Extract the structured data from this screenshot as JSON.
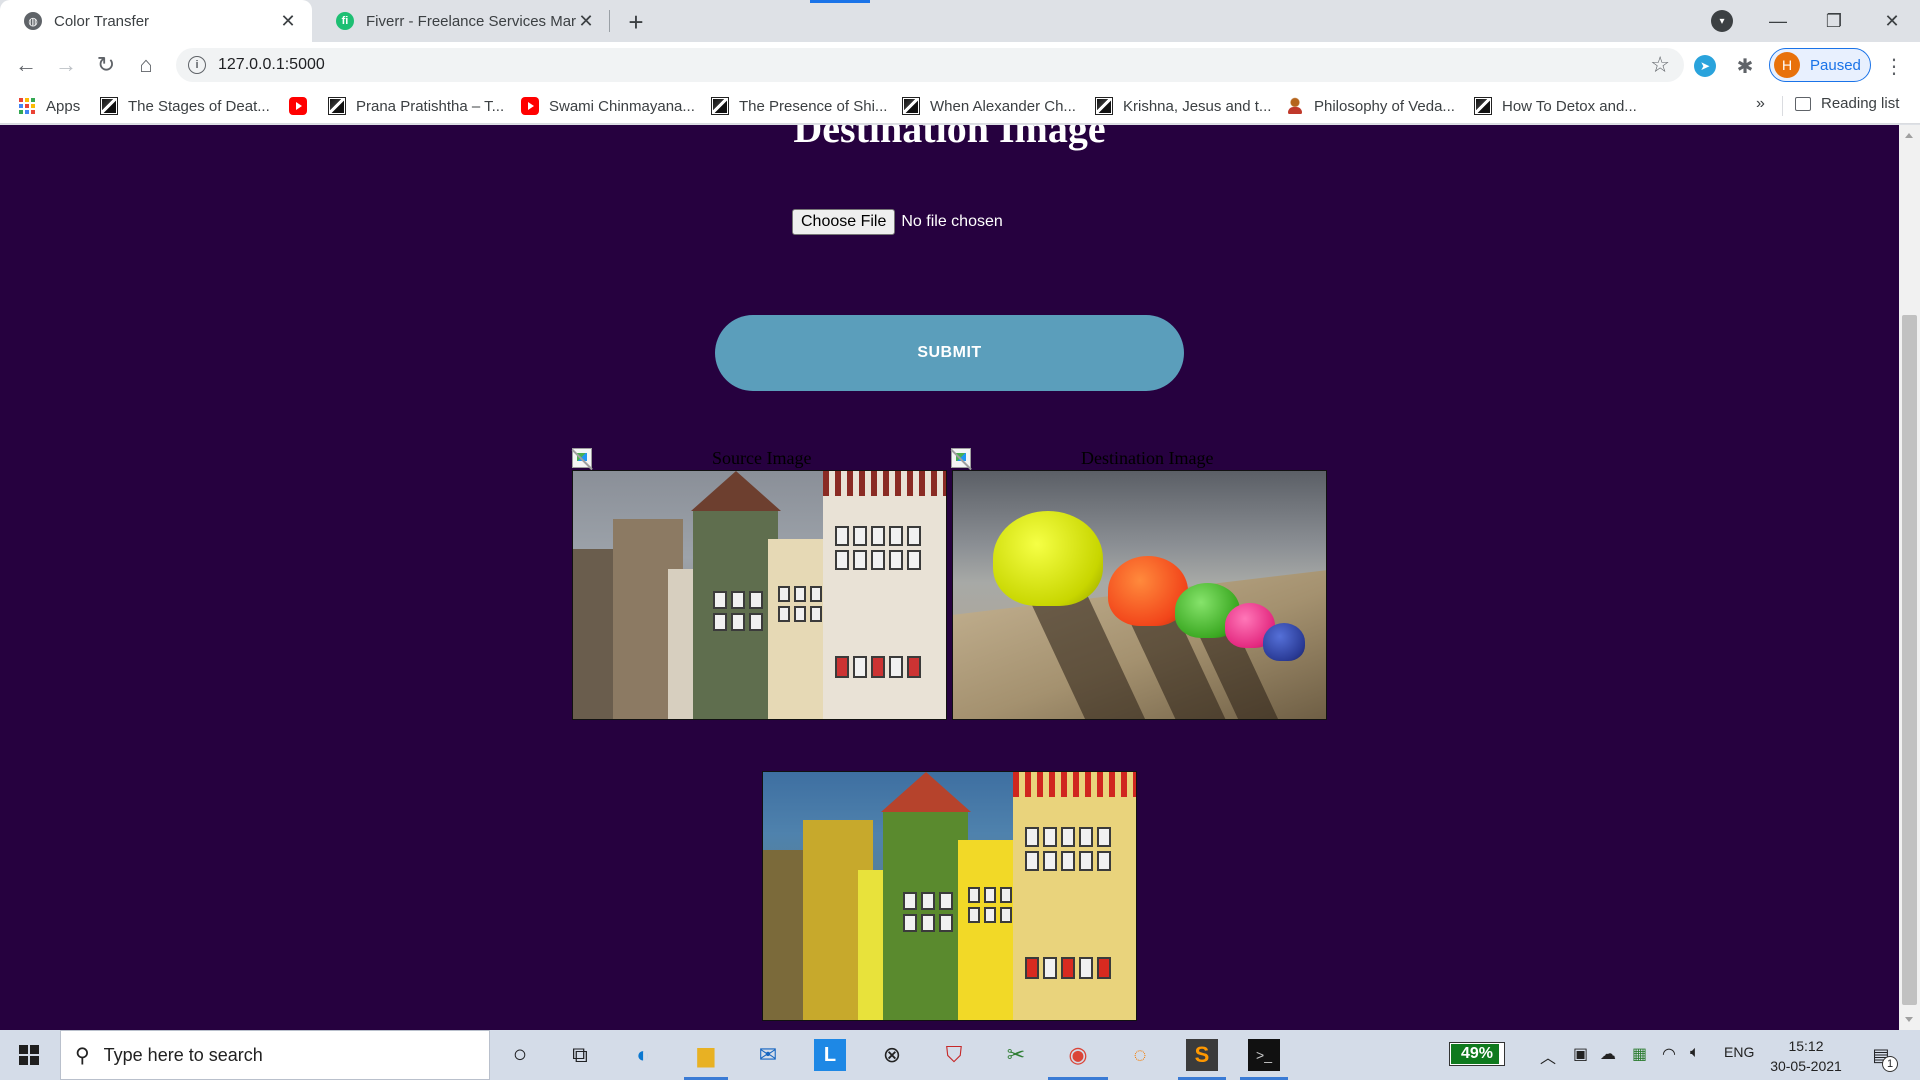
{
  "browser": {
    "tabs": [
      {
        "title": "Color Transfer",
        "active": true,
        "favicon": "globe-icon"
      },
      {
        "title": "Fiverr - Freelance Services Marke",
        "active": false,
        "favicon": "fiverr-icon"
      }
    ],
    "new_tab_symbol": "+",
    "url": "127.0.0.1:5000",
    "profile": {
      "initial": "H",
      "label": "Paused"
    },
    "bookmarks": [
      {
        "label": "Apps",
        "icon": "apps-grid-icon"
      },
      {
        "label": "The Stages of Deat...",
        "icon": "academia-icon"
      },
      {
        "label": "",
        "icon": "youtube-icon"
      },
      {
        "label": "Prana Pratishtha – T...",
        "icon": "academia-icon"
      },
      {
        "label": "Swami Chinmayana...",
        "icon": "youtube-icon"
      },
      {
        "label": "The Presence of Shi...",
        "icon": "academia-icon"
      },
      {
        "label": "When Alexander Ch...",
        "icon": "academia-icon"
      },
      {
        "label": "Krishna, Jesus and t...",
        "icon": "academia-icon"
      },
      {
        "label": "Philosophy of Veda...",
        "icon": "meditation-icon"
      },
      {
        "label": "How To Detox and...",
        "icon": "academia-icon"
      }
    ],
    "bookmarks_more": "»",
    "reading_list": "Reading list"
  },
  "page": {
    "heading": "Destination Image",
    "file_button": "Choose File",
    "file_status": "No file chosen",
    "submit_label": "SUBMIT",
    "source_alt": "Source Image",
    "destination_alt": "Destination Image",
    "background_color": "#26013f",
    "submit_color": "#5b9ebb"
  },
  "taskbar": {
    "search_placeholder": "Type here to search",
    "battery_percent": "49%",
    "language": "ENG",
    "time": "15:12",
    "date": "30-05-2021",
    "notification_count": "1"
  }
}
